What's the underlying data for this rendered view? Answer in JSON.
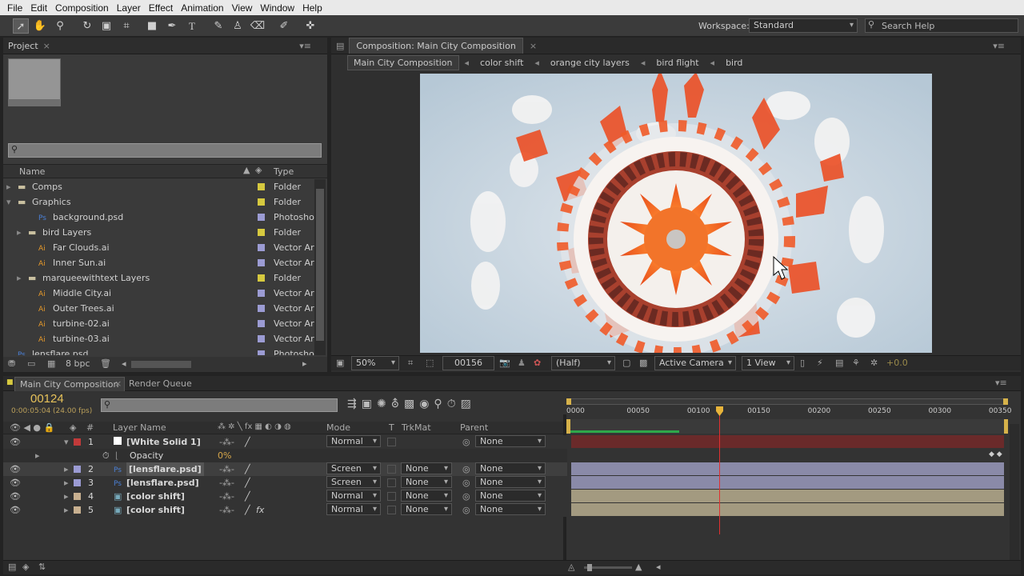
{
  "menu": [
    "File",
    "Edit",
    "Composition",
    "Layer",
    "Effect",
    "Animation",
    "View",
    "Window",
    "Help"
  ],
  "workspace": {
    "label": "Workspace:",
    "value": "Standard"
  },
  "search_help": {
    "placeholder": "Search Help"
  },
  "project": {
    "tab": "Project",
    "columns": {
      "name": "Name",
      "type": "Type"
    },
    "items": [
      {
        "name": "Comps",
        "type": "Folder",
        "kind": "folder",
        "color": "#d6c93f",
        "indent": 0,
        "expander": "▸"
      },
      {
        "name": "Graphics",
        "type": "Folder",
        "kind": "folder",
        "color": "#d6c93f",
        "indent": 0,
        "expander": "▾"
      },
      {
        "name": "background.psd",
        "type": "Photoshop",
        "kind": "psd",
        "color": "#9b9bd3",
        "indent": 2,
        "expander": ""
      },
      {
        "name": "bird Layers",
        "type": "Folder",
        "kind": "folder",
        "color": "#d6c93f",
        "indent": 1,
        "expander": "▸"
      },
      {
        "name": "Far Clouds.ai",
        "type": "Vector Art",
        "kind": "ai",
        "color": "#9b9bd3",
        "indent": 2,
        "expander": ""
      },
      {
        "name": "Inner Sun.ai",
        "type": "Vector Art",
        "kind": "ai",
        "color": "#9b9bd3",
        "indent": 2,
        "expander": ""
      },
      {
        "name": "marqueewithtext Layers",
        "type": "Folder",
        "kind": "folder",
        "color": "#d6c93f",
        "indent": 1,
        "expander": "▸"
      },
      {
        "name": "Middle City.ai",
        "type": "Vector Art",
        "kind": "ai",
        "color": "#9b9bd3",
        "indent": 2,
        "expander": ""
      },
      {
        "name": "Outer Trees.ai",
        "type": "Vector Art",
        "kind": "ai",
        "color": "#9b9bd3",
        "indent": 2,
        "expander": ""
      },
      {
        "name": "turbine-02.ai",
        "type": "Vector Art",
        "kind": "ai",
        "color": "#9b9bd3",
        "indent": 2,
        "expander": ""
      },
      {
        "name": "turbine-03.ai",
        "type": "Vector Art",
        "kind": "ai",
        "color": "#9b9bd3",
        "indent": 2,
        "expander": ""
      },
      {
        "name": "lensflare.psd",
        "type": "Photoshop",
        "kind": "psd",
        "color": "#9b9bd3",
        "indent": 0,
        "expander": ""
      }
    ],
    "bpc": "8 bpc"
  },
  "composition": {
    "tab": "Composition: Main City Composition",
    "breadcrumbs": [
      "Main City Composition",
      "color shift",
      "orange city layers",
      "bird flight",
      "bird"
    ],
    "zoom": "50%",
    "timecode": "00156",
    "resolution": "(Half)",
    "camera": "Active Camera",
    "views": "1 View",
    "exposure": "+0.0"
  },
  "timeline": {
    "tabs": [
      "Main City Composition",
      "Render Queue"
    ],
    "current_frame": "00124",
    "current_time": "0:00:05:04 (24.00 fps)",
    "headers": {
      "num": "#",
      "layer_name": "Layer Name",
      "mode": "Mode",
      "t": "T",
      "trkmat": "TrkMat",
      "parent": "Parent"
    },
    "ruler": [
      "0000",
      "00050",
      "00100",
      "00150",
      "00200",
      "00250",
      "00300",
      "00350"
    ],
    "layers": [
      {
        "num": "1",
        "name": "[White Solid 1]",
        "mode": "Normal",
        "trkmat": "",
        "parent": "None",
        "color": "#c23a3a",
        "bar": "#6a2a2a",
        "fx": ""
      },
      {
        "num": "2",
        "name": "[lensflare.psd]",
        "mode": "Screen",
        "trkmat": "None",
        "parent": "None",
        "color": "#9b9bd3",
        "bar": "#8a8aa8",
        "fx": ""
      },
      {
        "num": "3",
        "name": "[lensflare.psd]",
        "mode": "Screen",
        "trkmat": "None",
        "parent": "None",
        "color": "#9b9bd3",
        "bar": "#8a8aa8",
        "fx": ""
      },
      {
        "num": "4",
        "name": "[color shift]",
        "mode": "Normal",
        "trkmat": "None",
        "parent": "None",
        "color": "#c8b090",
        "bar": "#a39a80",
        "fx": ""
      },
      {
        "num": "5",
        "name": "[color shift]",
        "mode": "Normal",
        "trkmat": "None",
        "parent": "None",
        "color": "#c8b090",
        "bar": "#a39a80",
        "fx": "fx"
      }
    ],
    "opacity": {
      "label": "Opacity",
      "value": "0%"
    },
    "work_area_progress": 0.25,
    "playhead_frame": 124
  }
}
